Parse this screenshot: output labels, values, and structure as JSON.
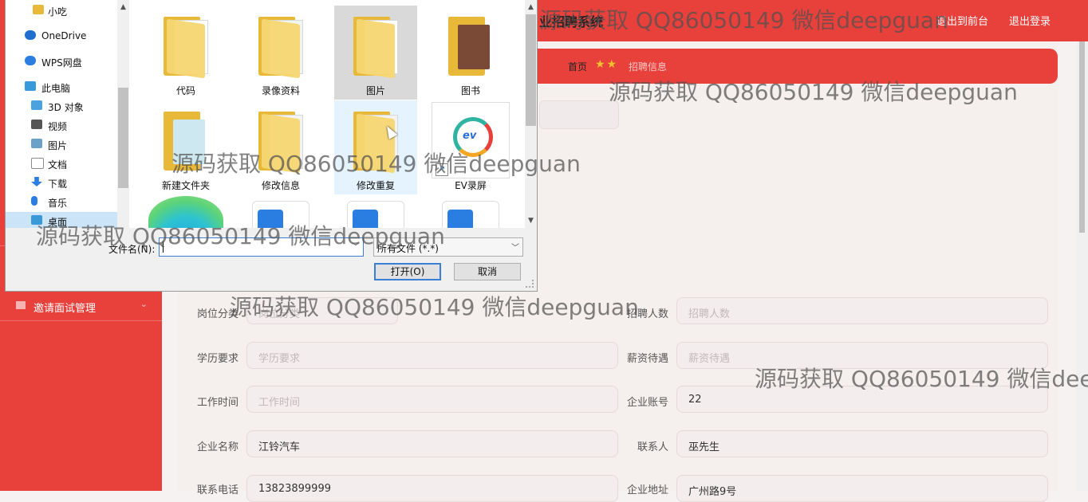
{
  "app": {
    "title": "业招聘系统",
    "top_links": [
      "退出到前台",
      "退出登录"
    ],
    "breadcrumb": {
      "home": "首页",
      "current": "招聘信息",
      "stars": "★★"
    },
    "sidebar": {
      "item_label": "邀请面试管理",
      "chevron": "⌄"
    },
    "form": {
      "rows": [
        [
          {
            "label": "岗位分类",
            "value": "",
            "placeholder": "岗位分类"
          },
          {
            "label": "招聘人数",
            "value": "",
            "placeholder": "招聘人数"
          }
        ],
        [
          {
            "label": "学历要求",
            "value": "",
            "placeholder": "学历要求"
          },
          {
            "label": "薪资待遇",
            "value": "",
            "placeholder": "薪资待遇"
          }
        ],
        [
          {
            "label": "工作时间",
            "value": "",
            "placeholder": "工作时间"
          },
          {
            "label": "企业账号",
            "value": "22",
            "placeholder": ""
          }
        ],
        [
          {
            "label": "企业名称",
            "value": "江铃汽车",
            "placeholder": ""
          },
          {
            "label": "联系人",
            "value": "巫先生",
            "placeholder": ""
          }
        ],
        [
          {
            "label": "联系电话",
            "value": "13823899999",
            "placeholder": ""
          },
          {
            "label": "企业地址",
            "value": "广州路9号",
            "placeholder": ""
          }
        ]
      ]
    }
  },
  "dialog": {
    "nav_items": [
      {
        "label": "小吃",
        "icon": "folder-icon",
        "color": "#e8b838"
      },
      {
        "label": "OneDrive",
        "icon": "cloud-icon",
        "color": "#1f6fd1"
      },
      {
        "label": "WPS网盘",
        "icon": "cloud-icon",
        "color": "#2a7de1"
      },
      {
        "label": "此电脑",
        "icon": "computer-icon",
        "color": "#3a9ad9"
      },
      {
        "label": "3D 对象",
        "icon": "cube-icon",
        "color": "#4aa3df"
      },
      {
        "label": "视频",
        "icon": "video-icon",
        "color": "#555555"
      },
      {
        "label": "图片",
        "icon": "image-icon",
        "color": "#6aa2c8"
      },
      {
        "label": "文档",
        "icon": "document-icon",
        "color": "#8a8a8a"
      },
      {
        "label": "下载",
        "icon": "download-icon",
        "color": "#2a7de1"
      },
      {
        "label": "音乐",
        "icon": "music-icon",
        "color": "#2a7de1"
      },
      {
        "label": "桌面",
        "icon": "desktop-icon",
        "color": "#3a9ad9"
      }
    ],
    "files": [
      {
        "label": "代码",
        "type": "folder"
      },
      {
        "label": "录像资料",
        "type": "folder-preview"
      },
      {
        "label": "图片",
        "type": "folder"
      },
      {
        "label": "图书",
        "type": "folder-food"
      },
      {
        "label": "新建文件夹",
        "type": "folder-preview"
      },
      {
        "label": "修改信息",
        "type": "folder-doc"
      },
      {
        "label": "修改重复",
        "type": "folder-doc"
      },
      {
        "label": "EV录屏",
        "type": "shortcut"
      }
    ],
    "filename_label": "文件名(N):",
    "filename_value": "",
    "filter_value": "所有文件 (*.*)",
    "open_label": "打开(O)",
    "cancel_label": "取消"
  },
  "watermark": "源码获取 QQ86050149 微信deepguan",
  "colors": {
    "accent": "#e8413c",
    "folder": "#e8b838",
    "focus": "#3b7ed6"
  }
}
